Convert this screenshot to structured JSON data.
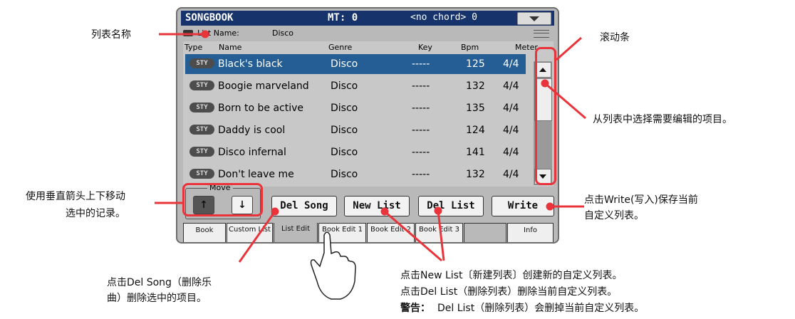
{
  "screen": {
    "title": "SONGBOOK",
    "mt": "MT: 0",
    "chord": "<no chord> 0",
    "list_name_label": "List Name:",
    "list_name_value": "Disco",
    "columns": [
      "Type",
      "Name",
      "Genre",
      "Key",
      "Bpm",
      "Meter"
    ],
    "rows": [
      {
        "type": "STY",
        "name": "Black's black",
        "genre": "Disco",
        "key": "-----",
        "bpm": "125",
        "meter": "4/4",
        "selected": true
      },
      {
        "type": "STY",
        "name": "Boogie marveland",
        "genre": "Disco",
        "key": "-----",
        "bpm": "132",
        "meter": "4/4"
      },
      {
        "type": "STY",
        "name": "Born to be active",
        "genre": "Disco",
        "key": "-----",
        "bpm": "135",
        "meter": "4/4"
      },
      {
        "type": "STY",
        "name": "Daddy is cool",
        "genre": "Disco",
        "key": "-----",
        "bpm": "124",
        "meter": "4/4"
      },
      {
        "type": "STY",
        "name": "Disco infernal",
        "genre": "Disco",
        "key": "-----",
        "bpm": "141",
        "meter": "4/4"
      },
      {
        "type": "STY",
        "name": "Don't leave me",
        "genre": "Disco",
        "key": "-----",
        "bpm": "132",
        "meter": "4/4"
      }
    ],
    "move_label": "Move",
    "move_up": "↑",
    "move_down": "↓",
    "buttons": {
      "del_song": "Del Song",
      "new_list": "New List",
      "del_list": "Del List",
      "write": "Write"
    },
    "tabs": [
      "Book",
      "Custom List",
      "List Edit",
      "Book Edit 1",
      "Book Edit 2",
      "Book Edit 3",
      "Info"
    ]
  },
  "annotations": {
    "list_name": "列表名称",
    "scrollbar": "滚动条",
    "select_item": "从列表中选择需要编辑的项目。",
    "move_arrows_line1": "使用垂直箭头上下移动",
    "move_arrows_line2": "选中的记录。",
    "write_line1": "点击Write(写入)保存当前",
    "write_line2": "自定义列表。",
    "del_song_line1": "点击Del Song（删除乐",
    "del_song_line2": "曲）删除选中的项目。",
    "new_list": "点击New List〔新建列表〕创建新的自定义列表。",
    "del_list": "点击Del List（删除列表）删除当前自定义列表。",
    "warning_label": "警告：",
    "warning_text": "Del List（删除列表）会删掉当前自定义列表。"
  },
  "colors": {
    "title_bar": "#16346b",
    "selected_row": "#245e94",
    "highlight": "#e8343a"
  }
}
